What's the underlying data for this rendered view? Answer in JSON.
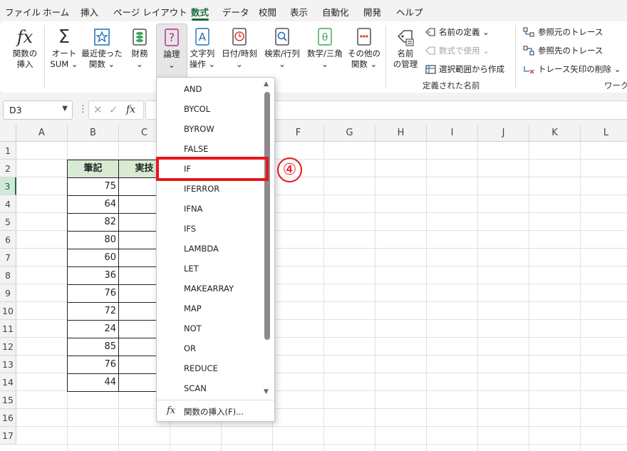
{
  "menu": {
    "tabs": [
      "ファイル",
      "ホーム",
      "挿入",
      "ページ レイアウト",
      "数式",
      "データ",
      "校閲",
      "表示",
      "自動化",
      "開発",
      "ヘルプ"
    ],
    "active": "数式"
  },
  "ribbon": {
    "insert_function": [
      "関数の",
      "挿入"
    ],
    "autosum": [
      "オート",
      "SUM ⌄"
    ],
    "recent": [
      "最近使った",
      "関数 ⌄"
    ],
    "financial": [
      "財務",
      "⌄"
    ],
    "logical": [
      "論理",
      "⌄"
    ],
    "text": [
      "文字列",
      "操作 ⌄"
    ],
    "datetime": [
      "日付/時刻",
      "⌄"
    ],
    "lookup": [
      "検索/行列",
      "⌄"
    ],
    "math": [
      "数学/三角",
      "⌄"
    ],
    "more": [
      "その他の",
      "関数 ⌄"
    ],
    "name_manager": [
      "名前",
      "の管理"
    ],
    "define_name": "名前の定義 ⌄",
    "use_in_formula": "数式で使用 ⌄",
    "create_from_selection": "選択範囲から作成",
    "defined_names_group": "定義された名前",
    "trace_precedents": "参照元のトレース",
    "trace_dependents": "参照先のトレース",
    "remove_arrows": "トレース矢印の削除 ⌄",
    "worksheet_group": "ワークシ"
  },
  "formula_bar": {
    "name_box": "D3",
    "fx": "fx"
  },
  "grid": {
    "columns": [
      "A",
      "B",
      "C",
      "D",
      "E",
      "F",
      "G",
      "H",
      "I",
      "J",
      "K",
      "L"
    ],
    "rows": [
      "1",
      "2",
      "3",
      "4",
      "5",
      "6",
      "7",
      "8",
      "9",
      "10",
      "11",
      "12",
      "13",
      "14",
      "15",
      "16",
      "17"
    ],
    "selected_col": "D",
    "selected_row": "3",
    "header_b": "筆記",
    "header_c": "実技",
    "values_b": [
      "75",
      "64",
      "82",
      "80",
      "60",
      "36",
      "76",
      "72",
      "24",
      "85",
      "76",
      "44"
    ]
  },
  "dropdown": {
    "items": [
      "AND",
      "BYCOL",
      "BYROW",
      "FALSE",
      "IF",
      "IFERROR",
      "IFNA",
      "IFS",
      "LAMBDA",
      "LET",
      "MAKEARRAY",
      "MAP",
      "NOT",
      "OR",
      "REDUCE",
      "SCAN"
    ],
    "footer_icon": "fx",
    "footer_label": "関数の挿入(F)...",
    "highlighted": "IF"
  },
  "annotation": {
    "step": "④",
    "color": "#e8151d"
  }
}
